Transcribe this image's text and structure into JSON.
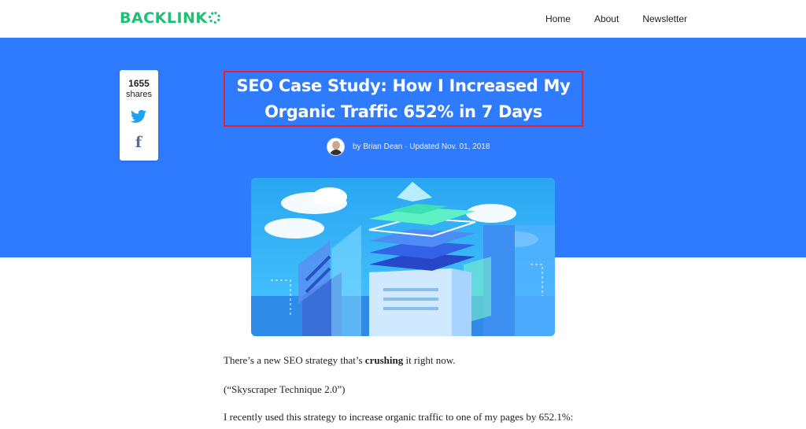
{
  "header": {
    "logo": "BACKLINK",
    "nav": [
      "Home",
      "About",
      "Newsletter"
    ]
  },
  "share": {
    "count": "1655",
    "label": "shares",
    "twitter_icon": "twitter-icon",
    "facebook_icon": "facebook-icon"
  },
  "post": {
    "title": "SEO Case Study: How I Increased My Organic Traffic 652% in 7 Days",
    "byline_prefix": "by",
    "author": "Brian Dean",
    "updated": "· Updated Nov. 01, 2018"
  },
  "article": {
    "p1_before": "There’s a new SEO strategy that’s ",
    "p1_bold": "crushing",
    "p1_after": " it right now.",
    "p2": "(“Skyscraper Technique 2.0”)",
    "p3": "I recently used this strategy to increase organic traffic to one of my pages by 652.1%:"
  },
  "colors": {
    "brand_green": "#1fbf75",
    "hero_blue": "#2f7bff",
    "highlight_red": "#e8202a"
  }
}
